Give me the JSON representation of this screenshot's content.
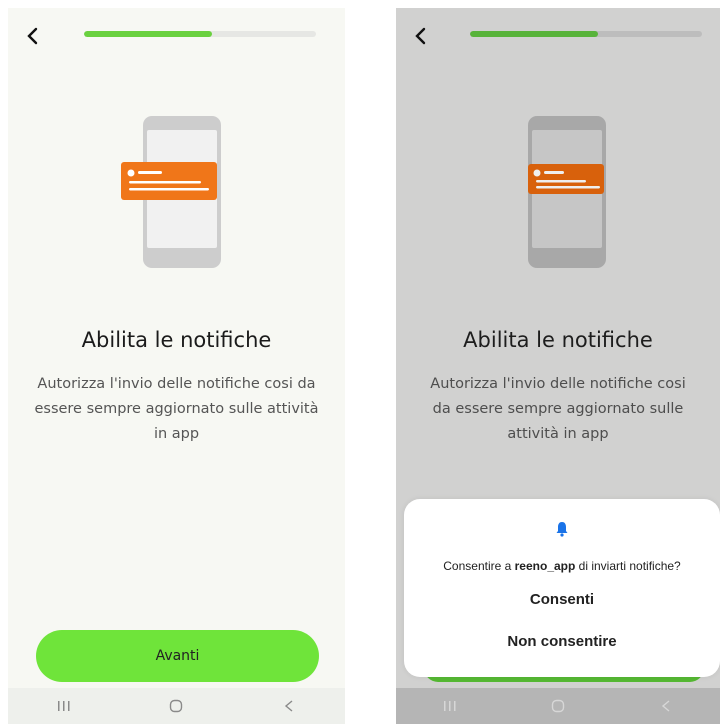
{
  "left": {
    "progress": 0.55,
    "title": "Abilita le notifiche",
    "description": "Autorizza l'invio delle notifiche cosi da essere sempre aggiornato sulle attività in app",
    "cta_label": "Avanti"
  },
  "right": {
    "progress": 0.55,
    "title": "Abilita le notifiche",
    "description": "Autorizza l'invio delle notifiche cosi da essere sempre aggiornato sulle attività in app",
    "dialog": {
      "message_prefix": "Consentire a",
      "app_name": "reeno_app",
      "message_suffix": "di inviarti notifiche?",
      "allow_label": "Consenti",
      "deny_label": "Non consentire"
    }
  },
  "icons": {
    "back": "chevron-left-icon",
    "bell": "bell-icon",
    "recent_apps": "recent-apps-icon",
    "home": "home-icon",
    "system_back": "back-arrow-icon"
  },
  "colors": {
    "accent_green": "#6fe43a",
    "progress_green": "#6ad13f",
    "notification_orange": "#f07619",
    "bell_blue": "#1a73e8"
  }
}
